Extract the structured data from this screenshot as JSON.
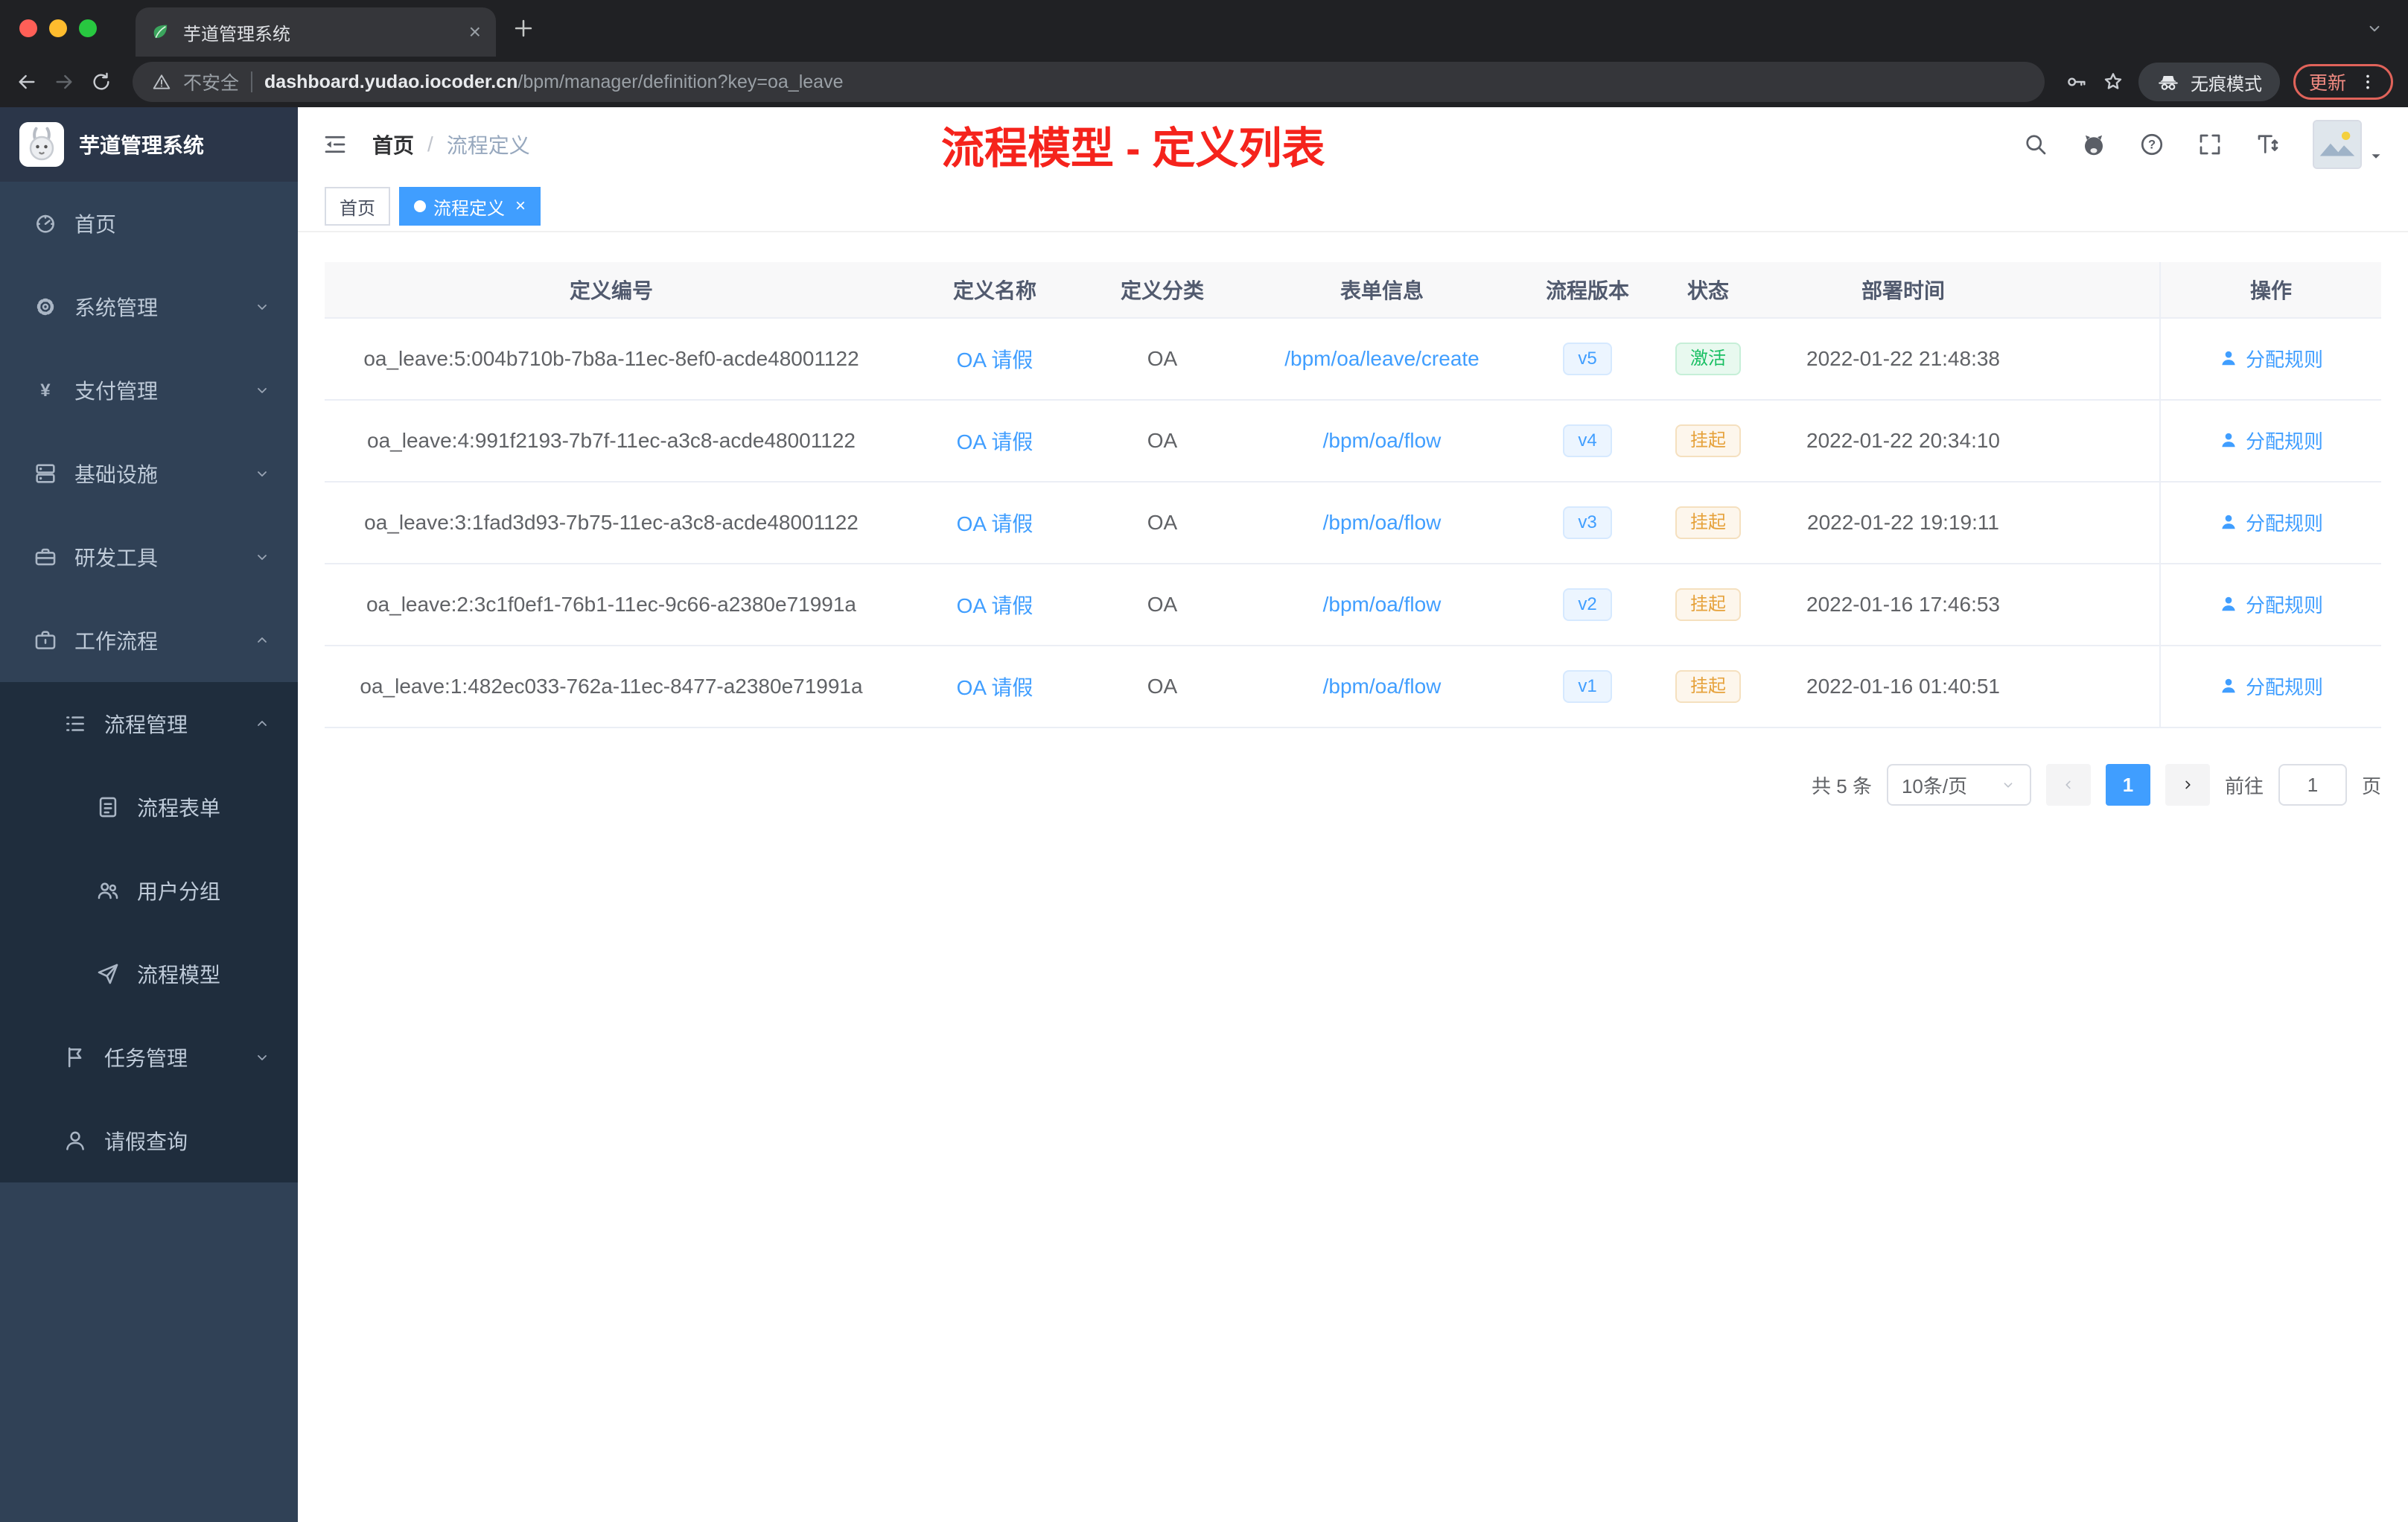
{
  "colors": {
    "accent": "#409eff",
    "annotation_red": "#f5231c",
    "status_active_text": "#18bf62",
    "status_suspend_text": "#e6a23c",
    "sidebar_bg": "#304156",
    "submenu_bg": "#1f2d3d"
  },
  "browser": {
    "tab": {
      "title": "芋道管理系统",
      "favicon": "leaf-icon"
    },
    "toolbar": {
      "security_label": "不安全",
      "url_host": "dashboard.yudao.iocoder.cn",
      "url_path": "/bpm/manager/definition?key=oa_leave",
      "incognito_label": "无痕模式",
      "update_label": "更新"
    }
  },
  "sidebar": {
    "brand": "芋道管理系统",
    "items": [
      {
        "key": "home",
        "icon": "dashboard-icon",
        "label": "首页",
        "level": 1,
        "arrow": null,
        "dark": false
      },
      {
        "key": "system",
        "icon": "gear-icon",
        "label": "系统管理",
        "level": 1,
        "arrow": "down",
        "dark": false
      },
      {
        "key": "payment",
        "icon": "yen-icon",
        "label": "支付管理",
        "level": 1,
        "arrow": "down",
        "dark": false
      },
      {
        "key": "infrastructure",
        "icon": "server-icon",
        "label": "基础设施",
        "level": 1,
        "arrow": "down",
        "dark": false
      },
      {
        "key": "devtools",
        "icon": "toolbox-icon",
        "label": "研发工具",
        "level": 1,
        "arrow": "down",
        "dark": false
      },
      {
        "key": "workflow",
        "icon": "briefcase-icon",
        "label": "工作流程",
        "level": 1,
        "arrow": "up",
        "dark": false
      },
      {
        "key": "process-manage",
        "icon": "list-icon",
        "label": "流程管理",
        "level": 2,
        "arrow": "up",
        "dark": true
      },
      {
        "key": "process-form",
        "icon": "form-icon",
        "label": "流程表单",
        "level": 3,
        "arrow": null,
        "dark": true
      },
      {
        "key": "user-group",
        "icon": "user-group-icon",
        "label": "用户分组",
        "level": 3,
        "arrow": null,
        "dark": true
      },
      {
        "key": "process-model",
        "icon": "paper-plane-icon",
        "label": "流程模型",
        "level": 3,
        "arrow": null,
        "dark": true
      },
      {
        "key": "task-manage",
        "icon": "task-icon",
        "label": "任务管理",
        "level": 2,
        "arrow": "down",
        "dark": true
      },
      {
        "key": "leave-query",
        "icon": "user-icon",
        "label": "请假查询",
        "level": 2,
        "arrow": null,
        "dark": true
      }
    ]
  },
  "navbar": {
    "breadcrumb": {
      "home": "首页",
      "separator": "/",
      "current": "流程定义"
    },
    "annotation": "流程模型 - 定义列表"
  },
  "tags": [
    {
      "label": "首页",
      "active": false
    },
    {
      "label": "流程定义",
      "active": true
    }
  ],
  "table": {
    "columns": [
      "定义编号",
      "定义名称",
      "定义分类",
      "表单信息",
      "流程版本",
      "状态",
      "部署时间",
      "操作"
    ],
    "rows": [
      {
        "id": "oa_leave:5:004b710b-7b8a-11ec-8ef0-acde48001122",
        "name": "OA 请假",
        "category": "OA",
        "form": "/bpm/oa/leave/create",
        "version": "v5",
        "status": "激活",
        "status_type": "success",
        "deployed_at": "2022-01-22 21:48:38",
        "action": "分配规则"
      },
      {
        "id": "oa_leave:4:991f2193-7b7f-11ec-a3c8-acde48001122",
        "name": "OA 请假",
        "category": "OA",
        "form": "/bpm/oa/flow",
        "version": "v4",
        "status": "挂起",
        "status_type": "warning",
        "deployed_at": "2022-01-22 20:34:10",
        "action": "分配规则"
      },
      {
        "id": "oa_leave:3:1fad3d93-7b75-11ec-a3c8-acde48001122",
        "name": "OA 请假",
        "category": "OA",
        "form": "/bpm/oa/flow",
        "version": "v3",
        "status": "挂起",
        "status_type": "warning",
        "deployed_at": "2022-01-22 19:19:11",
        "action": "分配规则"
      },
      {
        "id": "oa_leave:2:3c1f0ef1-76b1-11ec-9c66-a2380e71991a",
        "name": "OA 请假",
        "category": "OA",
        "form": "/bpm/oa/flow",
        "version": "v2",
        "status": "挂起",
        "status_type": "warning",
        "deployed_at": "2022-01-16 17:46:53",
        "action": "分配规则"
      },
      {
        "id": "oa_leave:1:482ec033-762a-11ec-8477-a2380e71991a",
        "name": "OA 请假",
        "category": "OA",
        "form": "/bpm/oa/flow",
        "version": "v1",
        "status": "挂起",
        "status_type": "warning",
        "deployed_at": "2022-01-16 01:40:51",
        "action": "分配规则"
      }
    ]
  },
  "pagination": {
    "total": "共 5 条",
    "page_size": "10条/页",
    "current": "1",
    "goto_label": "前往",
    "goto_value": "1",
    "page_unit": "页"
  }
}
